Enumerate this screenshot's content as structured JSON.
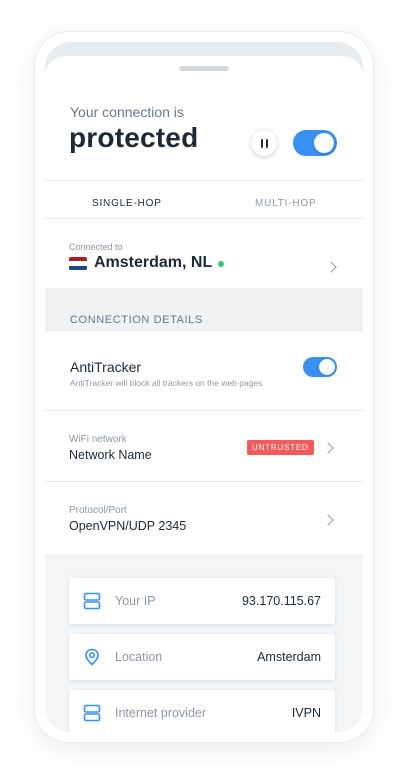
{
  "status": {
    "label": "Your connection is",
    "value": "protected"
  },
  "tabs": [
    {
      "label": "SINGLE-HOP",
      "active": true
    },
    {
      "label": "MULTI-HOP",
      "active": false
    }
  ],
  "connection": {
    "label": "Connected to",
    "city": "Amsterdam, NL",
    "flag_colors": [
      "#ae1c28",
      "#ffffff",
      "#21468b"
    ],
    "indicator_color": "#2fc96d"
  },
  "details": {
    "section_title": "CONNECTION DETAILS",
    "antitracker": {
      "title": "AntiTracker",
      "description": "AntiTracker will block all trackers on the web pages"
    },
    "wifi": {
      "label": "WiFi network",
      "value": "Network Name",
      "badge": "UNTRUSTED"
    },
    "protocol": {
      "label": "Protocol/Port",
      "value": "OpenVPN/UDP 2345"
    }
  },
  "info_cards": [
    {
      "icon": "server-icon",
      "label": "Your IP",
      "value": "93.170.115.67"
    },
    {
      "icon": "location-pin-icon",
      "label": "Location",
      "value": "Amsterdam"
    },
    {
      "icon": "server-icon",
      "label": "Internet provider",
      "value": "IVPN"
    }
  ],
  "colors": {
    "accent": "#3a8ff2",
    "danger": "#f45b5b",
    "text": "#1e2a36",
    "muted": "#8e98a3"
  }
}
